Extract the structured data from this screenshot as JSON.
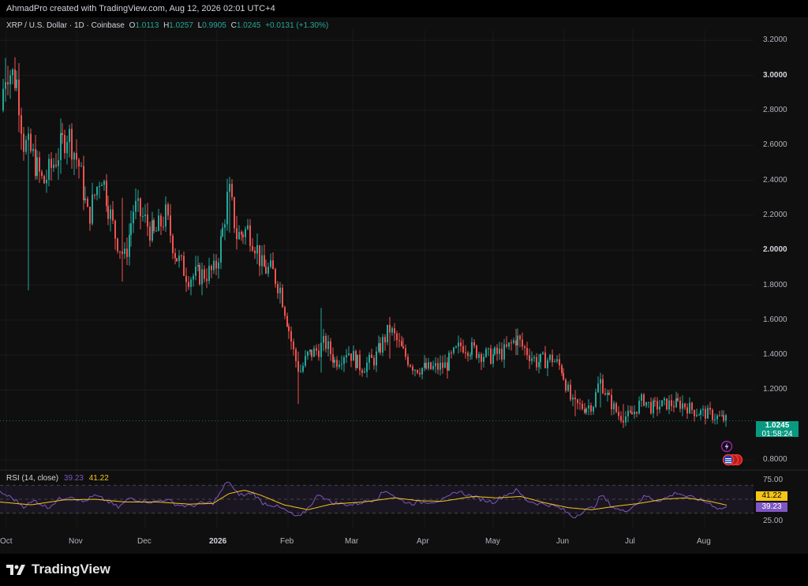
{
  "header": {
    "attribution": "AhmadPro created with TradingView.com, Aug 12, 2026 02:01 UTC+4"
  },
  "legend": {
    "symbol": "XRP / U.S. Dollar · 1D · Coinbase",
    "o_label": "O",
    "o": "1.0113",
    "h_label": "H",
    "h": "1.0257",
    "l_label": "L",
    "l": "0.9905",
    "c_label": "C",
    "c": "1.0245",
    "change": "+0.0131 (+1.30%)"
  },
  "price_tag": {
    "price": "1.0245",
    "countdown": "01:58:24"
  },
  "rsi_legend": {
    "label": "RSI (14, close)",
    "rsi": "39.23",
    "ma": "41.22"
  },
  "rsi_tags": {
    "ma": "41.22",
    "rsi": "39.23"
  },
  "footer": {
    "brand": "TradingView"
  },
  "colors": {
    "up": "#26a69a",
    "down": "#ef5350",
    "rsi": "#7e57c2",
    "rsi_ma": "#f5c518",
    "bg": "#0f0f0f"
  },
  "chart_data": {
    "type": "candlestick",
    "title": "XRP / U.S. Dollar · 1D · Coinbase",
    "price_axis": {
      "ticks": [
        "3.2000",
        "3.0000",
        "2.8000",
        "2.6000",
        "2.4000",
        "2.2000",
        "2.0000",
        "1.8000",
        "1.6000",
        "1.4000",
        "1.2000",
        "0.8000"
      ],
      "ylim": [
        0.76,
        3.26
      ]
    },
    "time_axis": {
      "ticks": [
        "Oct",
        "Nov",
        "Dec",
        "2026",
        "Feb",
        "Mar",
        "Apr",
        "May",
        "Jun",
        "Jul",
        "Aug"
      ]
    },
    "rsi_axis": {
      "ticks": [
        "75.00",
        "25.00"
      ],
      "ylim": [
        15,
        85
      ],
      "band": [
        30,
        70
      ]
    },
    "anchors": [
      {
        "x": 0,
        "v": 2.8
      },
      {
        "x": 8,
        "v": 3.05
      },
      {
        "x": 22,
        "v": 2.96
      },
      {
        "x": 30,
        "v": 2.62
      },
      {
        "x": 40,
        "v": 2.55
      },
      {
        "x": 55,
        "v": 2.38
      },
      {
        "x": 68,
        "v": 2.5
      },
      {
        "x": 86,
        "v": 2.68
      },
      {
        "x": 100,
        "v": 2.48
      },
      {
        "x": 112,
        "v": 2.18
      },
      {
        "x": 128,
        "v": 2.45
      },
      {
        "x": 145,
        "v": 2.1
      },
      {
        "x": 158,
        "v": 1.95
      },
      {
        "x": 170,
        "v": 2.25
      },
      {
        "x": 182,
        "v": 2.18
      },
      {
        "x": 195,
        "v": 2.08
      },
      {
        "x": 210,
        "v": 2.2
      },
      {
        "x": 222,
        "v": 1.98
      },
      {
        "x": 238,
        "v": 1.85
      },
      {
        "x": 255,
        "v": 1.86
      },
      {
        "x": 272,
        "v": 1.88
      },
      {
        "x": 282,
        "v": 2.1
      },
      {
        "x": 290,
        "v": 2.35
      },
      {
        "x": 300,
        "v": 2.08
      },
      {
        "x": 315,
        "v": 2.12
      },
      {
        "x": 325,
        "v": 2.02
      },
      {
        "x": 332,
        "v": 1.9
      },
      {
        "x": 345,
        "v": 1.88
      },
      {
        "x": 355,
        "v": 1.78
      },
      {
        "x": 365,
        "v": 1.58
      },
      {
        "x": 373,
        "v": 1.4
      },
      {
        "x": 380,
        "v": 1.3
      },
      {
        "x": 390,
        "v": 1.4
      },
      {
        "x": 400,
        "v": 1.42
      },
      {
        "x": 412,
        "v": 1.47
      },
      {
        "x": 425,
        "v": 1.36
      },
      {
        "x": 440,
        "v": 1.43
      },
      {
        "x": 458,
        "v": 1.33
      },
      {
        "x": 475,
        "v": 1.38
      },
      {
        "x": 494,
        "v": 1.55
      },
      {
        "x": 510,
        "v": 1.42
      },
      {
        "x": 525,
        "v": 1.33
      },
      {
        "x": 545,
        "v": 1.32
      },
      {
        "x": 565,
        "v": 1.34
      },
      {
        "x": 585,
        "v": 1.46
      },
      {
        "x": 600,
        "v": 1.43
      },
      {
        "x": 620,
        "v": 1.39
      },
      {
        "x": 640,
        "v": 1.42
      },
      {
        "x": 655,
        "v": 1.5
      },
      {
        "x": 662,
        "v": 1.45
      },
      {
        "x": 680,
        "v": 1.36
      },
      {
        "x": 700,
        "v": 1.38
      },
      {
        "x": 712,
        "v": 1.32
      },
      {
        "x": 725,
        "v": 1.12
      },
      {
        "x": 740,
        "v": 1.1
      },
      {
        "x": 752,
        "v": 1.12
      },
      {
        "x": 760,
        "v": 1.26
      },
      {
        "x": 770,
        "v": 1.16
      },
      {
        "x": 785,
        "v": 1.05
      },
      {
        "x": 800,
        "v": 1.05
      },
      {
        "x": 815,
        "v": 1.15
      },
      {
        "x": 825,
        "v": 1.1
      },
      {
        "x": 845,
        "v": 1.12
      },
      {
        "x": 865,
        "v": 1.12
      },
      {
        "x": 880,
        "v": 1.08
      },
      {
        "x": 900,
        "v": 1.06
      },
      {
        "x": 912,
        "v": 1.04
      },
      {
        "x": 922,
        "v": 1.0245
      }
    ],
    "spikes": [
      {
        "x": 8,
        "low": 2.85,
        "high": 3.1
      },
      {
        "x": 35,
        "low": 1.77,
        "high": 2.7
      },
      {
        "x": 156,
        "low": 1.82,
        "high": 2.3
      },
      {
        "x": 290,
        "low": 2.1,
        "high": 2.42
      },
      {
        "x": 378,
        "low": 1.12,
        "high": 1.42
      },
      {
        "x": 407,
        "low": 1.3,
        "high": 1.67
      },
      {
        "x": 494,
        "low": 1.38,
        "high": 1.61
      },
      {
        "x": 655,
        "low": 1.4,
        "high": 1.55
      },
      {
        "x": 728,
        "low": 1.05,
        "high": 1.2
      },
      {
        "x": 760,
        "low": 1.1,
        "high": 1.29
      },
      {
        "x": 790,
        "low": 1.02,
        "high": 1.12
      },
      {
        "x": 865,
        "low": 1.05,
        "high": 1.17
      }
    ],
    "rsi_anchors": [
      {
        "x": 0,
        "v": 60
      },
      {
        "x": 15,
        "v": 52
      },
      {
        "x": 30,
        "v": 40
      },
      {
        "x": 45,
        "v": 48
      },
      {
        "x": 60,
        "v": 38
      },
      {
        "x": 75,
        "v": 50
      },
      {
        "x": 90,
        "v": 55
      },
      {
        "x": 105,
        "v": 46
      },
      {
        "x": 120,
        "v": 55
      },
      {
        "x": 135,
        "v": 48
      },
      {
        "x": 150,
        "v": 38
      },
      {
        "x": 165,
        "v": 52
      },
      {
        "x": 180,
        "v": 48
      },
      {
        "x": 195,
        "v": 46
      },
      {
        "x": 210,
        "v": 50
      },
      {
        "x": 225,
        "v": 42
      },
      {
        "x": 240,
        "v": 40
      },
      {
        "x": 255,
        "v": 44
      },
      {
        "x": 270,
        "v": 45
      },
      {
        "x": 280,
        "v": 60
      },
      {
        "x": 289,
        "v": 78
      },
      {
        "x": 298,
        "v": 60
      },
      {
        "x": 310,
        "v": 55
      },
      {
        "x": 320,
        "v": 60
      },
      {
        "x": 332,
        "v": 45
      },
      {
        "x": 345,
        "v": 42
      },
      {
        "x": 360,
        "v": 35
      },
      {
        "x": 372,
        "v": 27
      },
      {
        "x": 380,
        "v": 24
      },
      {
        "x": 392,
        "v": 40
      },
      {
        "x": 405,
        "v": 58
      },
      {
        "x": 418,
        "v": 46
      },
      {
        "x": 430,
        "v": 44
      },
      {
        "x": 445,
        "v": 42
      },
      {
        "x": 460,
        "v": 46
      },
      {
        "x": 475,
        "v": 50
      },
      {
        "x": 490,
        "v": 63
      },
      {
        "x": 505,
        "v": 50
      },
      {
        "x": 520,
        "v": 44
      },
      {
        "x": 535,
        "v": 46
      },
      {
        "x": 550,
        "v": 47
      },
      {
        "x": 565,
        "v": 50
      },
      {
        "x": 580,
        "v": 62
      },
      {
        "x": 595,
        "v": 55
      },
      {
        "x": 610,
        "v": 50
      },
      {
        "x": 625,
        "v": 46
      },
      {
        "x": 640,
        "v": 56
      },
      {
        "x": 655,
        "v": 63
      },
      {
        "x": 668,
        "v": 48
      },
      {
        "x": 682,
        "v": 44
      },
      {
        "x": 697,
        "v": 42
      },
      {
        "x": 712,
        "v": 36
      },
      {
        "x": 727,
        "v": 24
      },
      {
        "x": 740,
        "v": 34
      },
      {
        "x": 752,
        "v": 38
      },
      {
        "x": 762,
        "v": 56
      },
      {
        "x": 775,
        "v": 40
      },
      {
        "x": 790,
        "v": 32
      },
      {
        "x": 805,
        "v": 42
      },
      {
        "x": 818,
        "v": 55
      },
      {
        "x": 832,
        "v": 48
      },
      {
        "x": 845,
        "v": 52
      },
      {
        "x": 858,
        "v": 60
      },
      {
        "x": 870,
        "v": 54
      },
      {
        "x": 885,
        "v": 50
      },
      {
        "x": 900,
        "v": 44
      },
      {
        "x": 912,
        "v": 36
      },
      {
        "x": 922,
        "v": 39.23
      }
    ],
    "rsi_ma_anchors": [
      {
        "x": 0,
        "v": 46
      },
      {
        "x": 40,
        "v": 42
      },
      {
        "x": 80,
        "v": 49
      },
      {
        "x": 120,
        "v": 50
      },
      {
        "x": 160,
        "v": 46
      },
      {
        "x": 200,
        "v": 46
      },
      {
        "x": 240,
        "v": 43
      },
      {
        "x": 270,
        "v": 44
      },
      {
        "x": 290,
        "v": 58
      },
      {
        "x": 310,
        "v": 63
      },
      {
        "x": 330,
        "v": 56
      },
      {
        "x": 360,
        "v": 42
      },
      {
        "x": 390,
        "v": 35
      },
      {
        "x": 420,
        "v": 43
      },
      {
        "x": 460,
        "v": 46
      },
      {
        "x": 500,
        "v": 52
      },
      {
        "x": 530,
        "v": 48
      },
      {
        "x": 560,
        "v": 47
      },
      {
        "x": 600,
        "v": 54
      },
      {
        "x": 630,
        "v": 52
      },
      {
        "x": 660,
        "v": 54
      },
      {
        "x": 690,
        "v": 45
      },
      {
        "x": 720,
        "v": 38
      },
      {
        "x": 750,
        "v": 35
      },
      {
        "x": 780,
        "v": 40
      },
      {
        "x": 810,
        "v": 44
      },
      {
        "x": 840,
        "v": 50
      },
      {
        "x": 870,
        "v": 52
      },
      {
        "x": 900,
        "v": 47
      },
      {
        "x": 922,
        "v": 41.22
      }
    ]
  }
}
